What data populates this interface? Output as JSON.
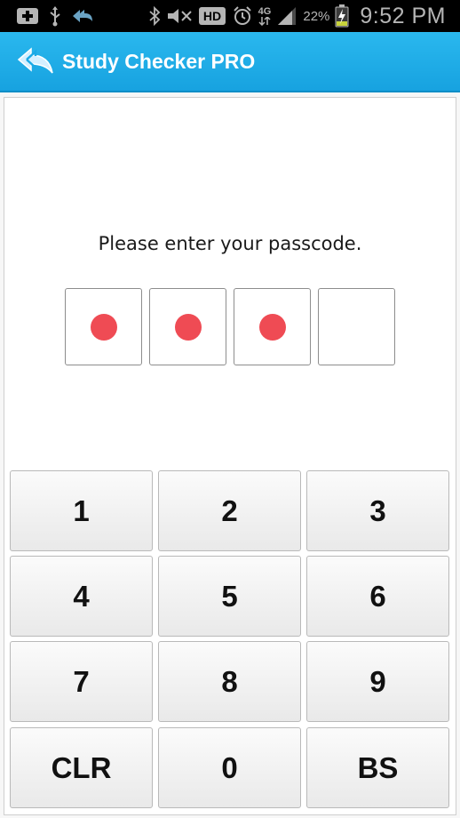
{
  "status_bar": {
    "battery_percent": "22%",
    "network": "4G",
    "time": "9:52 PM",
    "icons": [
      "add-notification-icon",
      "usb-icon",
      "double-arrow-back-icon",
      "bluetooth-icon",
      "mute-icon",
      "hd-icon",
      "alarm-icon",
      "network-4g-icon",
      "signal-icon",
      "battery-charging-icon"
    ]
  },
  "action_bar": {
    "title": "Study Checker PRO",
    "logo_icon": "double-back-arrow-icon",
    "color": "#1aa9e6"
  },
  "passcode": {
    "prompt": "Please enter your passcode.",
    "digits": [
      {
        "filled": true
      },
      {
        "filled": true
      },
      {
        "filled": true
      },
      {
        "filled": false
      }
    ],
    "dot_color": "#ef4b54"
  },
  "keypad": {
    "keys": [
      "1",
      "2",
      "3",
      "4",
      "5",
      "6",
      "7",
      "8",
      "9",
      "CLR",
      "0",
      "BS"
    ]
  }
}
